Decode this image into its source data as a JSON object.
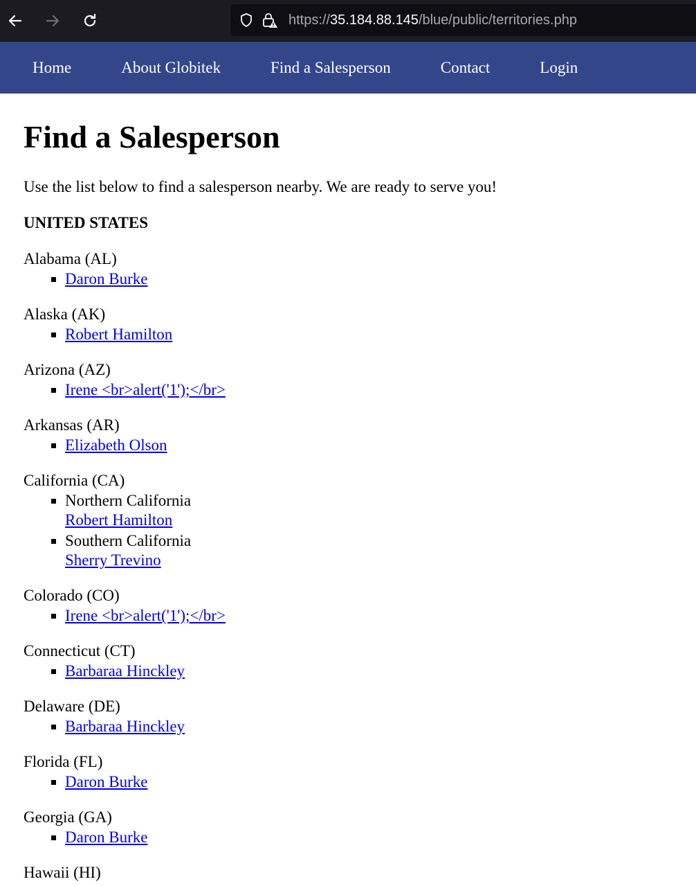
{
  "browser": {
    "url_prefix": "https://",
    "url_host": "35.184.88.145",
    "url_path": "/blue/public/territories.php"
  },
  "nav": {
    "items": [
      "Home",
      "About Globitek",
      "Find a Salesperson",
      "Contact",
      "Login"
    ]
  },
  "page": {
    "title": "Find a Salesperson",
    "intro": "Use the list below to find a salesperson nearby. We are ready to serve you!",
    "country": "UNITED STATES",
    "states": [
      {
        "name": "Alabama (AL)",
        "reps": [
          {
            "region": "",
            "name": "Daron Burke"
          }
        ]
      },
      {
        "name": "Alaska (AK)",
        "reps": [
          {
            "region": "",
            "name": "Robert Hamilton"
          }
        ]
      },
      {
        "name": "Arizona (AZ)",
        "reps": [
          {
            "region": "",
            "name": "Irene <br>alert('1');</br>"
          }
        ]
      },
      {
        "name": "Arkansas (AR)",
        "reps": [
          {
            "region": "",
            "name": "Elizabeth Olson"
          }
        ]
      },
      {
        "name": "California (CA)",
        "reps": [
          {
            "region": "Northern California",
            "name": "Robert Hamilton"
          },
          {
            "region": "Southern California",
            "name": "Sherry Trevino"
          }
        ]
      },
      {
        "name": "Colorado (CO)",
        "reps": [
          {
            "region": "",
            "name": "Irene <br>alert('1');</br>"
          }
        ]
      },
      {
        "name": "Connecticut (CT)",
        "reps": [
          {
            "region": "",
            "name": "Barbaraa Hinckley"
          }
        ]
      },
      {
        "name": "Delaware (DE)",
        "reps": [
          {
            "region": "",
            "name": "Barbaraa Hinckley"
          }
        ]
      },
      {
        "name": "Florida (FL)",
        "reps": [
          {
            "region": "",
            "name": "Daron Burke"
          }
        ]
      },
      {
        "name": "Georgia (GA)",
        "reps": [
          {
            "region": "",
            "name": "Daron Burke"
          }
        ]
      },
      {
        "name": "Hawaii (HI)",
        "reps": []
      }
    ]
  }
}
